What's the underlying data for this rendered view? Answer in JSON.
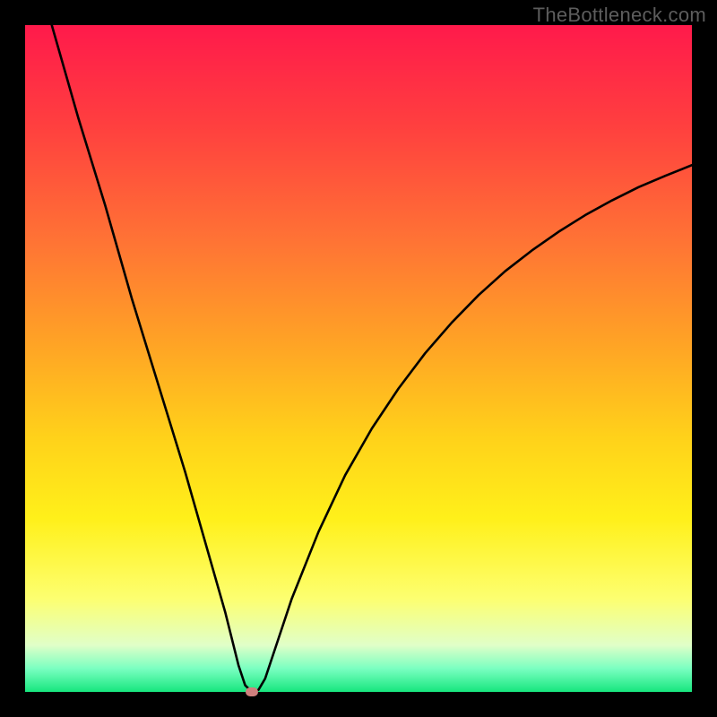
{
  "watermark": {
    "text": "TheBottleneck.com"
  },
  "colors": {
    "frame": "#000000",
    "watermark": "#5d5d5d",
    "curve": "#000000",
    "marker": "#cf7f7d",
    "gradient_stops": [
      {
        "offset": 0.0,
        "color": "#ff1a4b"
      },
      {
        "offset": 0.15,
        "color": "#ff3f3f"
      },
      {
        "offset": 0.32,
        "color": "#ff7235"
      },
      {
        "offset": 0.48,
        "color": "#ffa425"
      },
      {
        "offset": 0.62,
        "color": "#ffd21a"
      },
      {
        "offset": 0.74,
        "color": "#fff01a"
      },
      {
        "offset": 0.86,
        "color": "#fdff70"
      },
      {
        "offset": 0.93,
        "color": "#e0ffc8"
      },
      {
        "offset": 0.965,
        "color": "#7affc1"
      },
      {
        "offset": 1.0,
        "color": "#17e67e"
      }
    ]
  },
  "chart_data": {
    "type": "line",
    "title": "",
    "xlabel": "",
    "ylabel": "",
    "xlim": [
      0,
      100
    ],
    "ylim": [
      0,
      100
    ],
    "minimum": {
      "x": 34,
      "y": 0
    },
    "curve_points": [
      {
        "x": 4,
        "y": 100
      },
      {
        "x": 8,
        "y": 86
      },
      {
        "x": 12,
        "y": 73
      },
      {
        "x": 16,
        "y": 59
      },
      {
        "x": 20,
        "y": 46
      },
      {
        "x": 24,
        "y": 33
      },
      {
        "x": 28,
        "y": 19
      },
      {
        "x": 30,
        "y": 12
      },
      {
        "x": 32,
        "y": 4
      },
      {
        "x": 33,
        "y": 1
      },
      {
        "x": 34,
        "y": 0
      },
      {
        "x": 35,
        "y": 0.3
      },
      {
        "x": 36,
        "y": 2
      },
      {
        "x": 38,
        "y": 8
      },
      {
        "x": 40,
        "y": 14
      },
      {
        "x": 44,
        "y": 24
      },
      {
        "x": 48,
        "y": 32.5
      },
      {
        "x": 52,
        "y": 39.5
      },
      {
        "x": 56,
        "y": 45.5
      },
      {
        "x": 60,
        "y": 50.8
      },
      {
        "x": 64,
        "y": 55.4
      },
      {
        "x": 68,
        "y": 59.5
      },
      {
        "x": 72,
        "y": 63.1
      },
      {
        "x": 76,
        "y": 66.2
      },
      {
        "x": 80,
        "y": 69
      },
      {
        "x": 84,
        "y": 71.5
      },
      {
        "x": 88,
        "y": 73.7
      },
      {
        "x": 92,
        "y": 75.7
      },
      {
        "x": 96,
        "y": 77.4
      },
      {
        "x": 100,
        "y": 79
      }
    ]
  }
}
